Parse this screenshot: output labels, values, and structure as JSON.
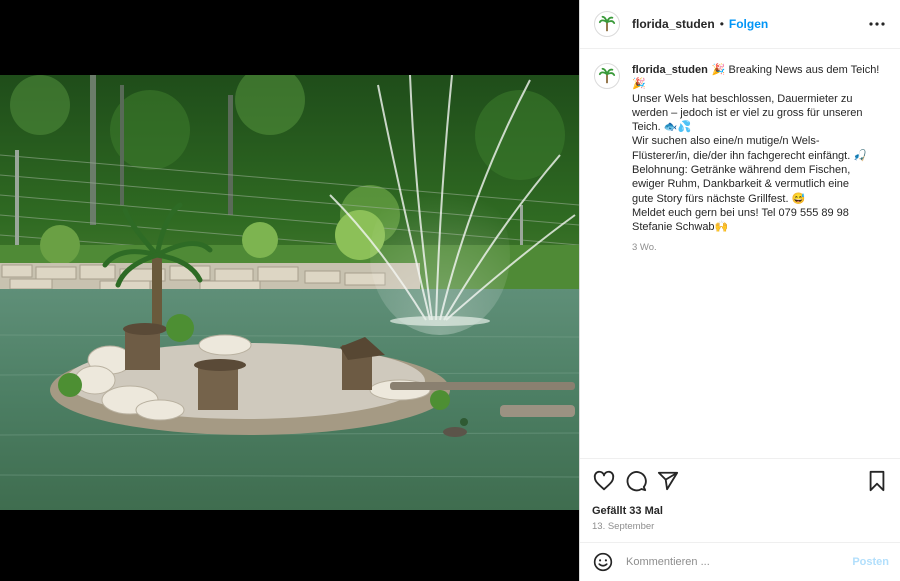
{
  "post": {
    "username": "florida_studen",
    "follow_label": "Folgen",
    "dot": "•",
    "more_icon": "more-horizontal-icon"
  },
  "caption": {
    "username": "florida_studen",
    "lines": [
      "🎉 Breaking News aus dem Teich!",
      "🎉",
      "Unser Wels hat beschlossen, Dauermieter zu",
      "werden – jedoch ist er viel zu gross für unseren",
      "Teich. 🐟💦",
      "Wir suchen also eine/n mutige/n Wels-",
      "Flüsterer/in, die/der ihn fachgerecht einfängt. 🎣",
      "Belohnung: Getränke während dem Fischen,",
      "ewiger Ruhm, Dankbarkeit & vermutlich eine",
      "gute Story fürs nächste Grillfest. 😅",
      "Meldet euch gern bei uns! Tel 079 555 89 98",
      "Stefanie Schwab🙌"
    ],
    "age": "3 Wo."
  },
  "actions": {
    "likes": "Gefällt 33 Mal",
    "date": "13. September"
  },
  "comment": {
    "placeholder": "Kommentieren ...",
    "post_label": "Posten"
  },
  "colors": {
    "link_blue": "#0095f6",
    "post_disabled": "#b2dffc",
    "muted": "#8e8e8e",
    "text": "#262626"
  }
}
